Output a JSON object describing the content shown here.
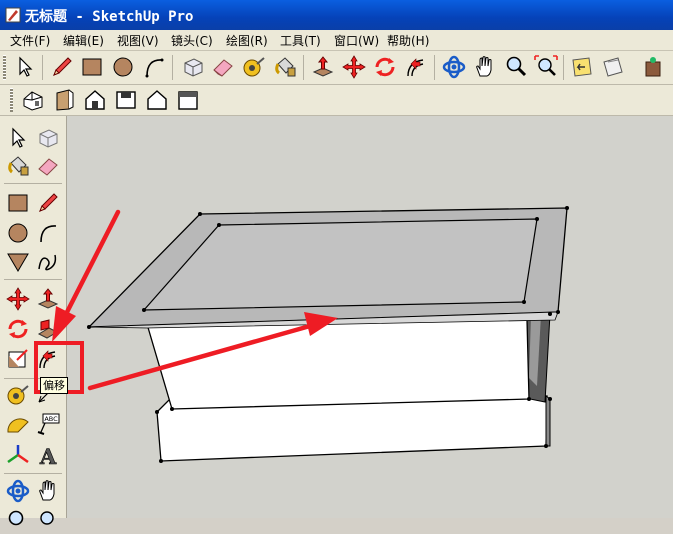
{
  "window": {
    "title": "无标题 - SketchUp Pro"
  },
  "menu": [
    "文件(F)",
    "编辑(E)",
    "视图(V)",
    "镜头(C)",
    "绘图(R)",
    "工具(T)",
    "窗口(W)",
    "帮助(H)"
  ],
  "toolbar_main": [
    "select-icon",
    "pencil-icon",
    "rectangle-icon",
    "circle-icon",
    "arc-icon",
    "eraser-icon",
    "paint-eraser-icon",
    "tape-measure-icon",
    "paint-bucket-icon",
    "push-pull-icon",
    "move-icon",
    "rotate-icon",
    "offset-icon",
    "orbit-icon",
    "pan-icon",
    "zoom-icon",
    "zoom-extents-icon",
    "previous-view-icon",
    "next-view-icon",
    "components-icon"
  ],
  "toolbar_views": [
    "iso-view-icon",
    "right-view-icon",
    "front-view-icon",
    "top-view-icon",
    "back-view-icon",
    "left-view-icon"
  ],
  "tooltip": {
    "text": "偏移",
    "for": "offset-tool"
  },
  "tape_label": "ABC",
  "colors": {
    "highlight": "#ee1c24",
    "arrow": "#ee1c24",
    "titlebar": "#0542b8",
    "canvas": "#d2d2cc"
  }
}
